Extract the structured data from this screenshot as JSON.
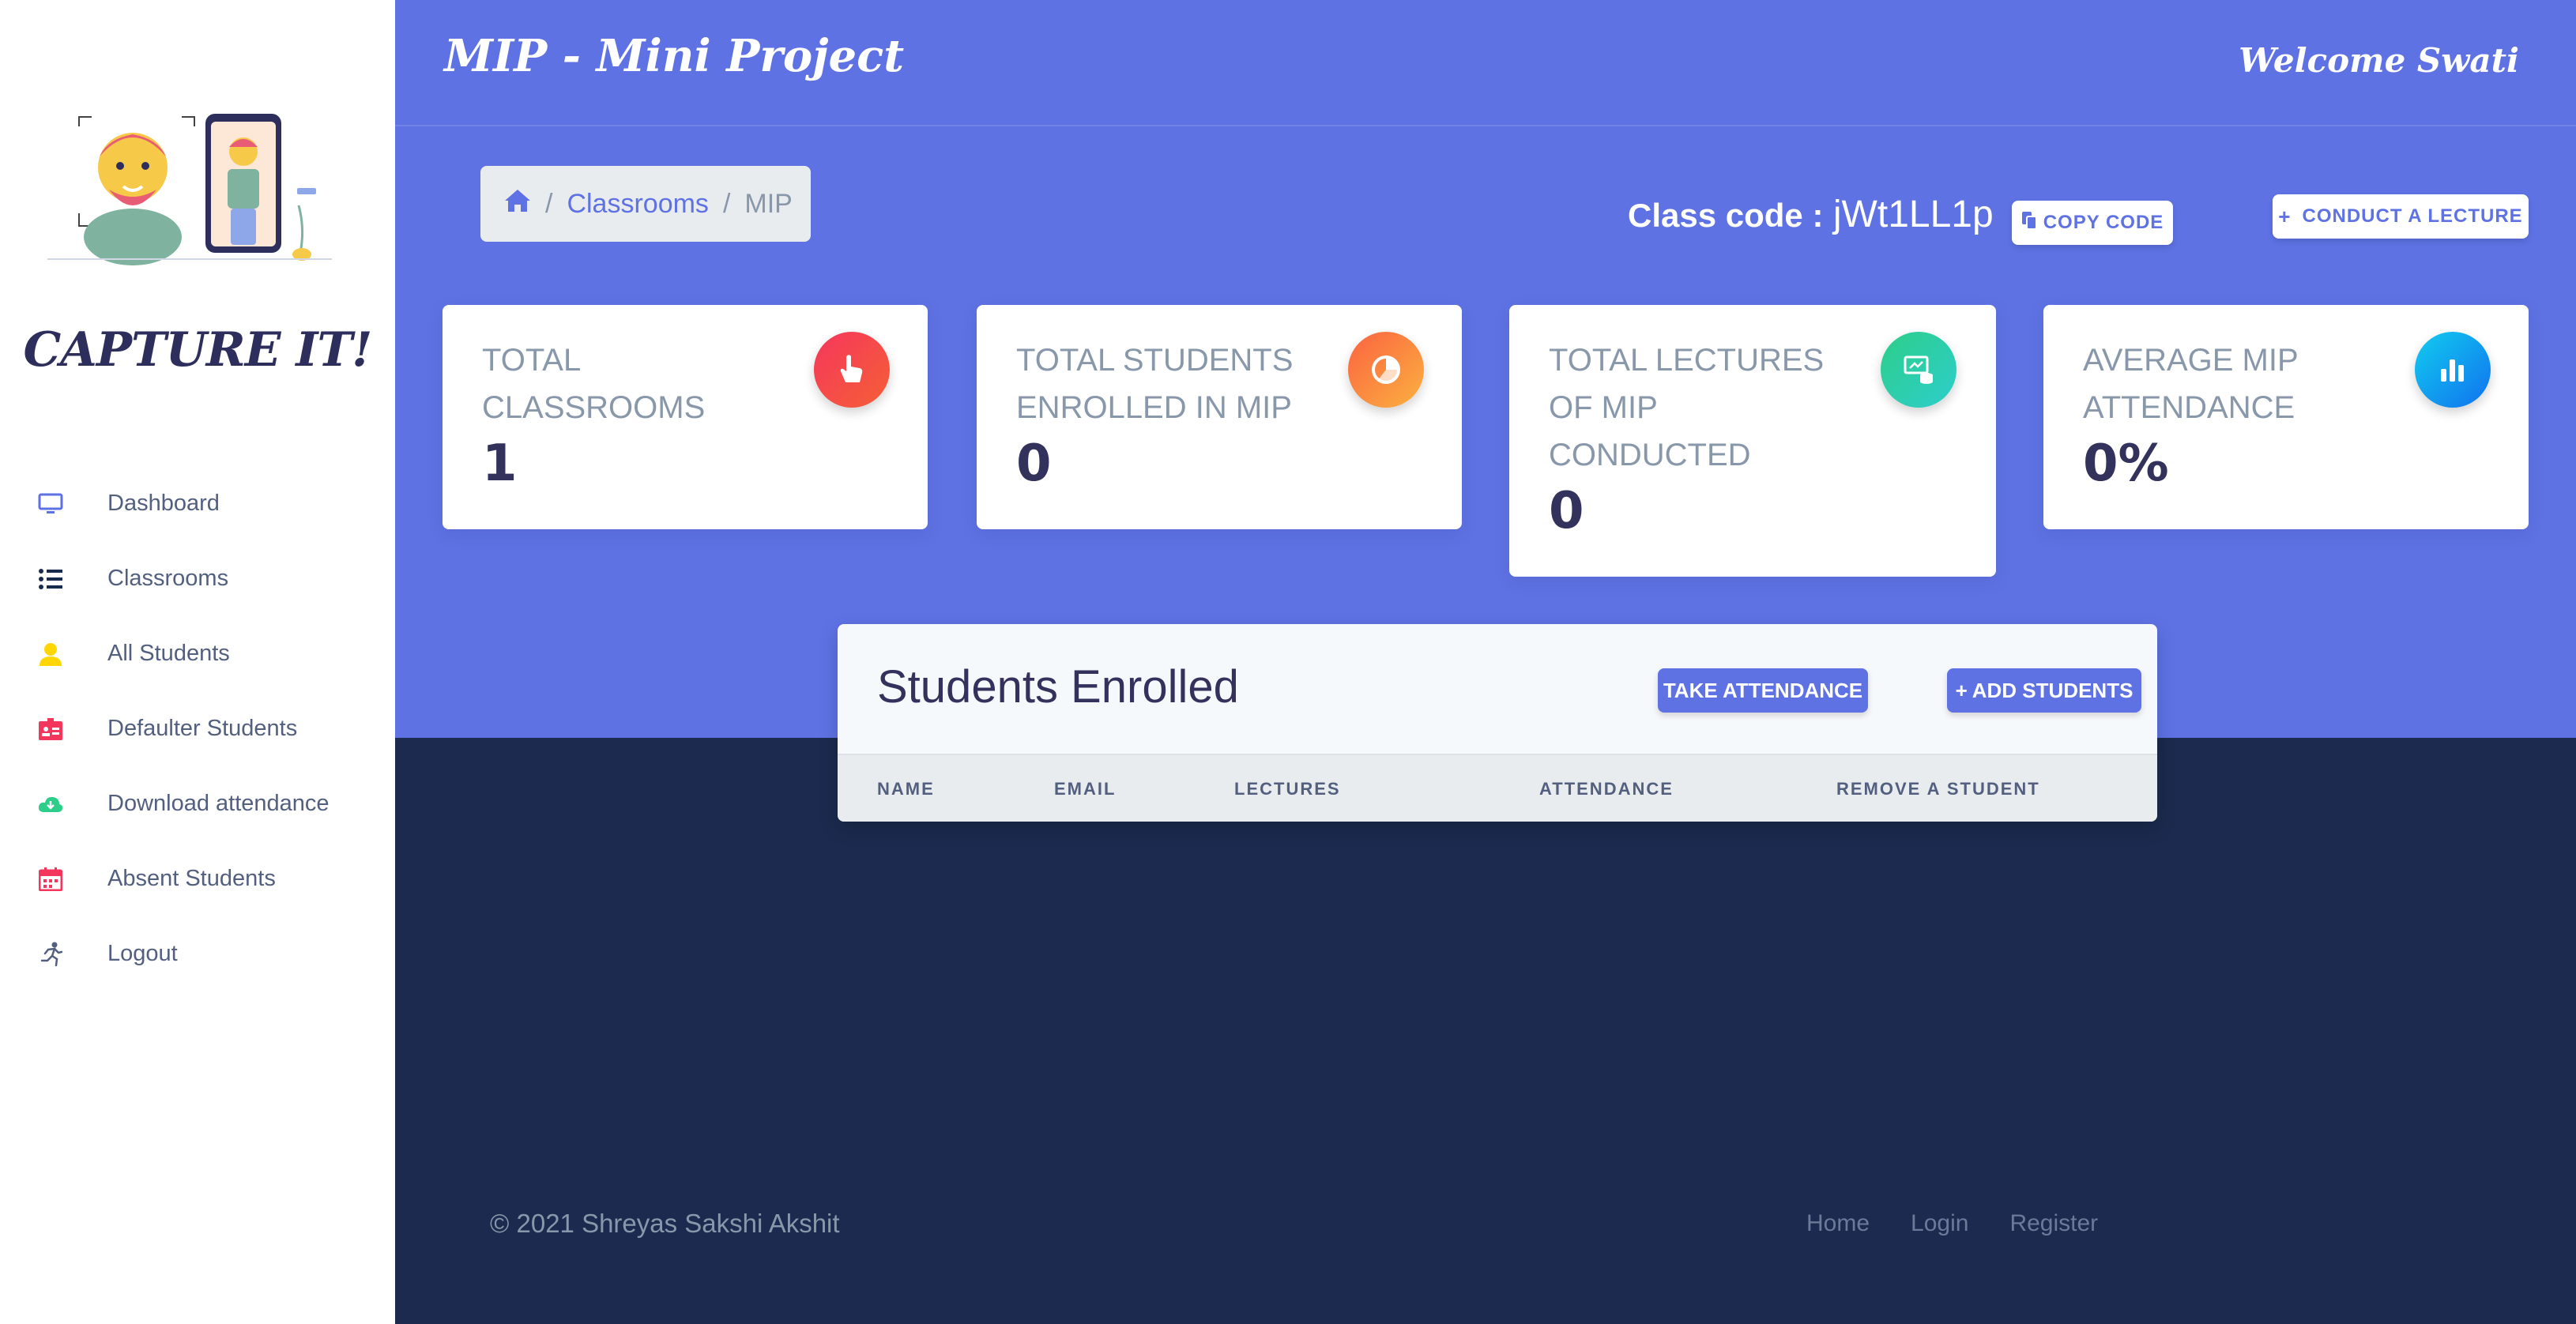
{
  "header": {
    "title": "MIP - Mini Project",
    "welcome": "Welcome Swati"
  },
  "brand": {
    "name": "CAPTURE IT!"
  },
  "sidebar": {
    "items": [
      {
        "label": "Dashboard",
        "icon": "monitor-icon",
        "color": "#5e72e4"
      },
      {
        "label": "Classrooms",
        "icon": "list-icon",
        "color": "#172b4d"
      },
      {
        "label": "All Students",
        "icon": "user-icon",
        "color": "#ffd600"
      },
      {
        "label": "Defaulter Students",
        "icon": "id-card-icon",
        "color": "#f5365c"
      },
      {
        "label": "Download attendance",
        "icon": "cloud-download-icon",
        "color": "#2dce89"
      },
      {
        "label": "Absent Students",
        "icon": "calendar-icon",
        "color": "#f5365c"
      },
      {
        "label": "Logout",
        "icon": "running-person-icon",
        "color": "#525f7f"
      }
    ]
  },
  "breadcrumb": {
    "home_icon": "home-icon",
    "items": [
      "Classrooms",
      "MIP"
    ]
  },
  "classcode": {
    "label": "Class code :",
    "value": "jWt1LL1p",
    "copy_label": "COPY CODE",
    "copy_icon": "copy-icon"
  },
  "actions": {
    "conduct_lecture": "CONDUCT A LECTURE"
  },
  "stats": [
    {
      "title": "TOTAL CLASSROOMS",
      "value": "1",
      "icon": "hand-pointer-icon",
      "color": "#f5365c"
    },
    {
      "title": "TOTAL STUDENTS ENROLLED IN MIP",
      "value": "0",
      "icon": "pie-chart-icon",
      "color": "#fb6340"
    },
    {
      "title": "TOTAL LECTURES OF MIP CONDUCTED",
      "value": "0",
      "icon": "presentation-icon",
      "color": "#2dce89"
    },
    {
      "title": "AVERAGE MIP ATTENDANCE",
      "value": "0%",
      "icon": "bar-chart-icon",
      "color": "#11cdef"
    }
  ],
  "students_panel": {
    "title": "Students Enrolled",
    "take_attendance": "TAKE ATTENDANCE",
    "add_students": "ADD STUDENTS",
    "columns": [
      "NAME",
      "EMAIL",
      "LECTURES",
      "ATTENDANCE",
      "REMOVE A STUDENT"
    ]
  },
  "footer": {
    "copyright": "© 2021 Shreyas Sakshi Akshit",
    "links": [
      "Home",
      "Login",
      "Register"
    ]
  },
  "colors": {
    "primary": "#5e72e4",
    "dark_bg": "#1b2a4e",
    "sidebar_bg": "#ffffff"
  }
}
